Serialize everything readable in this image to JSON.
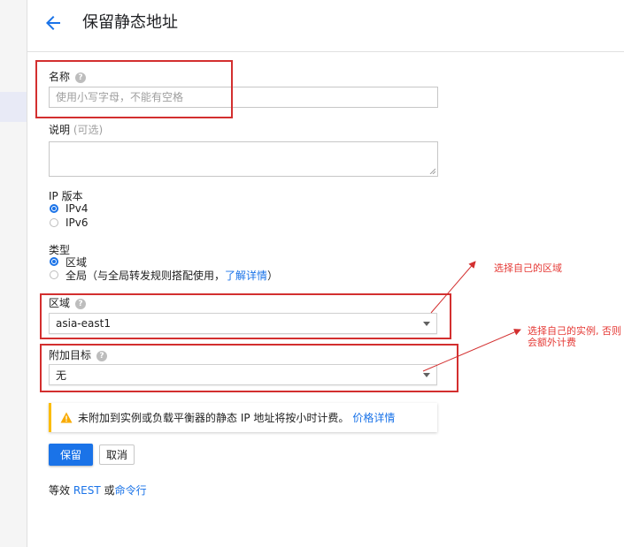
{
  "header": {
    "title": "保留静态地址"
  },
  "name_field": {
    "label": "名称",
    "placeholder": "使用小写字母，不能有空格"
  },
  "description_field": {
    "label": "说明",
    "optional": "(可选)"
  },
  "ip_version": {
    "label": "IP 版本",
    "options": [
      "IPv4",
      "IPv6"
    ],
    "selected": "IPv4"
  },
  "type": {
    "label": "类型",
    "option_regional": "区域",
    "option_global_prefix": "全局（与全局转发规则搭配使用，",
    "option_global_link": "了解详情",
    "option_global_suffix": "）",
    "selected": "区域"
  },
  "region": {
    "label": "区域",
    "value": "asia-east1"
  },
  "attach_target": {
    "label": "附加目标",
    "value": "无"
  },
  "warning": {
    "text": "未附加到实例或负载平衡器的静态 IP 地址将按小时计费。",
    "link": "价格详情"
  },
  "actions": {
    "reserve": "保留",
    "cancel": "取消"
  },
  "footer": {
    "prefix": "等效",
    "rest": "REST",
    "middle": "或",
    "cmd": "命令行"
  },
  "annotations": {
    "region_note": "选择自己的区域",
    "target_note": "选择自己的实例, 否则会额外计费"
  },
  "colors": {
    "accent": "#1a73e8",
    "annotation": "#d32f2f",
    "warning": "#fbbc04"
  }
}
